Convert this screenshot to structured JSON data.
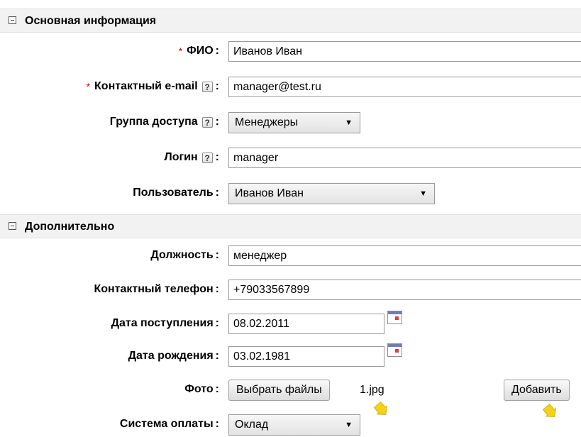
{
  "sections": [
    {
      "title": "Основная информация"
    },
    {
      "title": "Дополнительно"
    }
  ],
  "fields": {
    "fio": {
      "label": "ФИО",
      "value": "Иванов Иван"
    },
    "email": {
      "label": "Контактный e-mail",
      "value": "manager@test.ru"
    },
    "access_group": {
      "label": "Группа доступа",
      "value": "Менеджеры"
    },
    "login": {
      "label": "Логин",
      "value": "manager"
    },
    "user": {
      "label": "Пользователь",
      "value": "Иванов Иван"
    },
    "position": {
      "label": "Должность",
      "value": "менеджер"
    },
    "phone": {
      "label": "Контактный телефон",
      "value": "+79033567899"
    },
    "hire_date": {
      "label": "Дата поступления",
      "value": "08.02.2011"
    },
    "birth_date": {
      "label": "Дата рождения",
      "value": "03.02.1981"
    },
    "photo": {
      "label": "Фото",
      "button": "Выбрать файлы",
      "file_name": "1.jpg",
      "add_button": "Добавить"
    },
    "payment": {
      "label": "Система оплаты",
      "value": "Оклад"
    }
  },
  "symbols": {
    "required": "*",
    "help": "?",
    "colon": ":",
    "dropdown_arrow": "▼"
  },
  "colors": {
    "required": "#dd0000",
    "pointer": "#f2d21a"
  }
}
